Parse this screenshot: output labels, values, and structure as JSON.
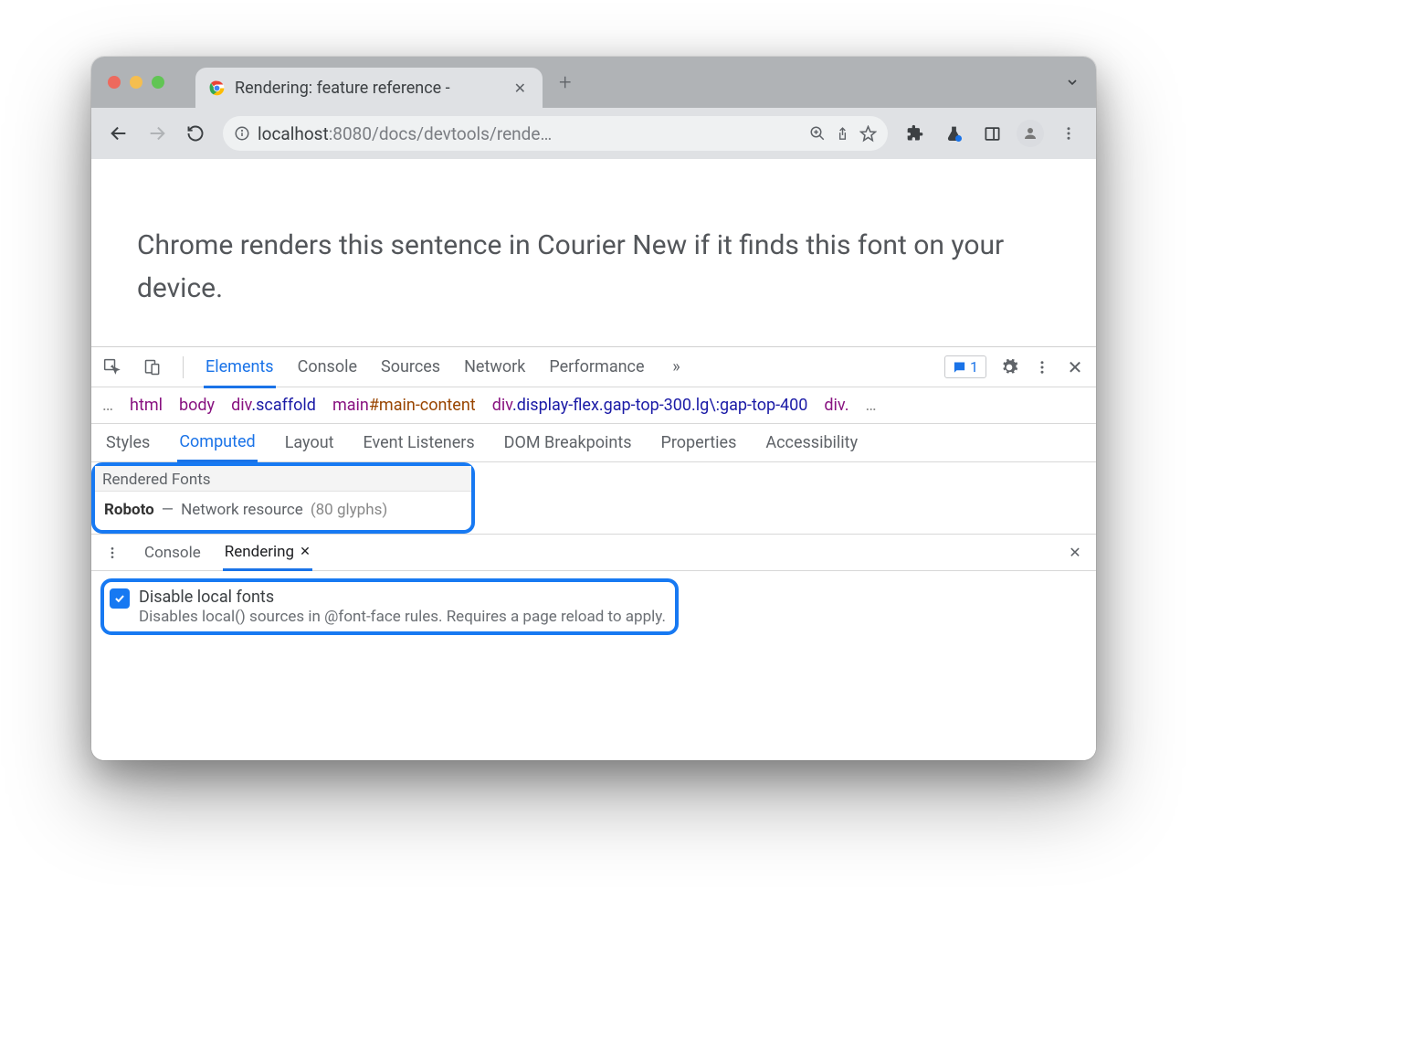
{
  "browser": {
    "tab_title": "Rendering: feature reference -",
    "url_prefix": "localhost",
    "url_rest": ":8080/docs/devtools/rende…"
  },
  "page": {
    "sentence": "Chrome renders this sentence in Courier New if it finds this font on your device."
  },
  "devtools": {
    "tabs": [
      "Elements",
      "Console",
      "Sources",
      "Network",
      "Performance"
    ],
    "active_tab": "Elements",
    "issues_count": "1",
    "breadcrumb": [
      {
        "tag": "html"
      },
      {
        "tag": "body"
      },
      {
        "tag": "div",
        "cls": ".scaffold"
      },
      {
        "tag": "main",
        "id": "#main-content"
      },
      {
        "tag": "div",
        "cls": ".display-flex.gap-top-300.lg\\:gap-top-400"
      },
      {
        "tag": "div.",
        "cls": ""
      }
    ],
    "subtabs": [
      "Styles",
      "Computed",
      "Layout",
      "Event Listeners",
      "DOM Breakpoints",
      "Properties",
      "Accessibility"
    ],
    "active_subtab": "Computed",
    "rendered_fonts": {
      "header": "Rendered Fonts",
      "font_name": "Roboto",
      "dash": "—",
      "source": "Network resource",
      "glyphs": "(80 glyphs)"
    },
    "drawer": {
      "tabs": [
        "Console",
        "Rendering"
      ],
      "active": "Rendering",
      "option_title": "Disable local fonts",
      "option_desc": "Disables local() sources in @font-face rules. Requires a page reload to apply."
    }
  }
}
